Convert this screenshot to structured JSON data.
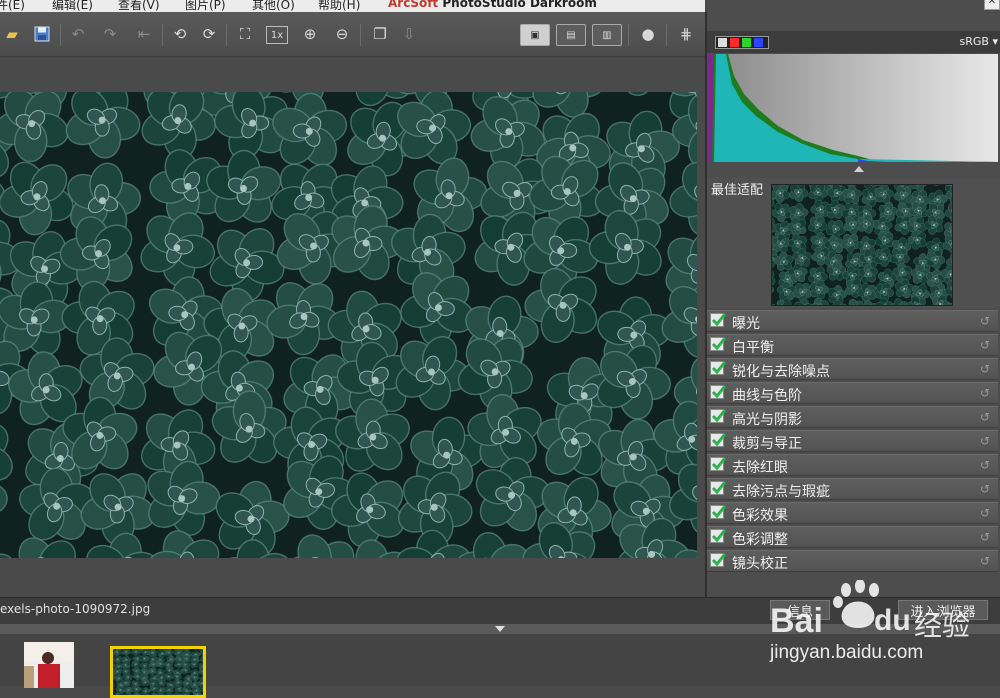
{
  "menu": {
    "items": [
      "件(E)",
      "编辑(E)",
      "查看(V)",
      "图片(P)",
      "其他(O)",
      "帮助(H)"
    ],
    "app_brand": "ArcSoft",
    "app_title": "PhotoStudio Darkroom"
  },
  "toolbar": {
    "icons": [
      "open-icon",
      "save-icon",
      "undo-icon",
      "redo-icon",
      "revert-icon",
      "rotate-left-icon",
      "rotate-right-icon",
      "fit-screen-icon",
      "actual-size-icon",
      "zoom-in-icon",
      "zoom-out-icon",
      "batch-icon",
      "export-icon",
      "view-single-icon",
      "view-compare-icon",
      "view-split-icon",
      "sphere-icon",
      "grid-icon"
    ],
    "actual_size_label": "1x"
  },
  "histogram": {
    "color_space": "sRGB",
    "colors": {
      "red": "#ff2a2a",
      "green": "#2ad62a",
      "blue": "#2a44ff",
      "cyan": "#1eb6b6"
    }
  },
  "navigator": {
    "label": "最佳适配"
  },
  "adjustments": [
    {
      "label": "曝光",
      "checked": true
    },
    {
      "label": "白平衡",
      "checked": true
    },
    {
      "label": "锐化与去除噪点",
      "checked": true
    },
    {
      "label": "曲线与色阶",
      "checked": true
    },
    {
      "label": "高光与阴影",
      "checked": true
    },
    {
      "label": "裁剪与导正",
      "checked": true
    },
    {
      "label": "去除红眼",
      "checked": true
    },
    {
      "label": "去除污点与瑕疵",
      "checked": true
    },
    {
      "label": "色彩效果",
      "checked": true
    },
    {
      "label": "色彩调整",
      "checked": true
    },
    {
      "label": "镜头校正",
      "checked": true
    }
  ],
  "status": {
    "filename": "exels-photo-1090972.jpg",
    "info_button": "信息",
    "browser_button": "进入浏览器"
  },
  "watermark": {
    "brand": "Bai",
    "brand2": "du",
    "brand_cn": "经验",
    "url": "jingyan.baidu.com"
  },
  "accent": "#f2d200"
}
